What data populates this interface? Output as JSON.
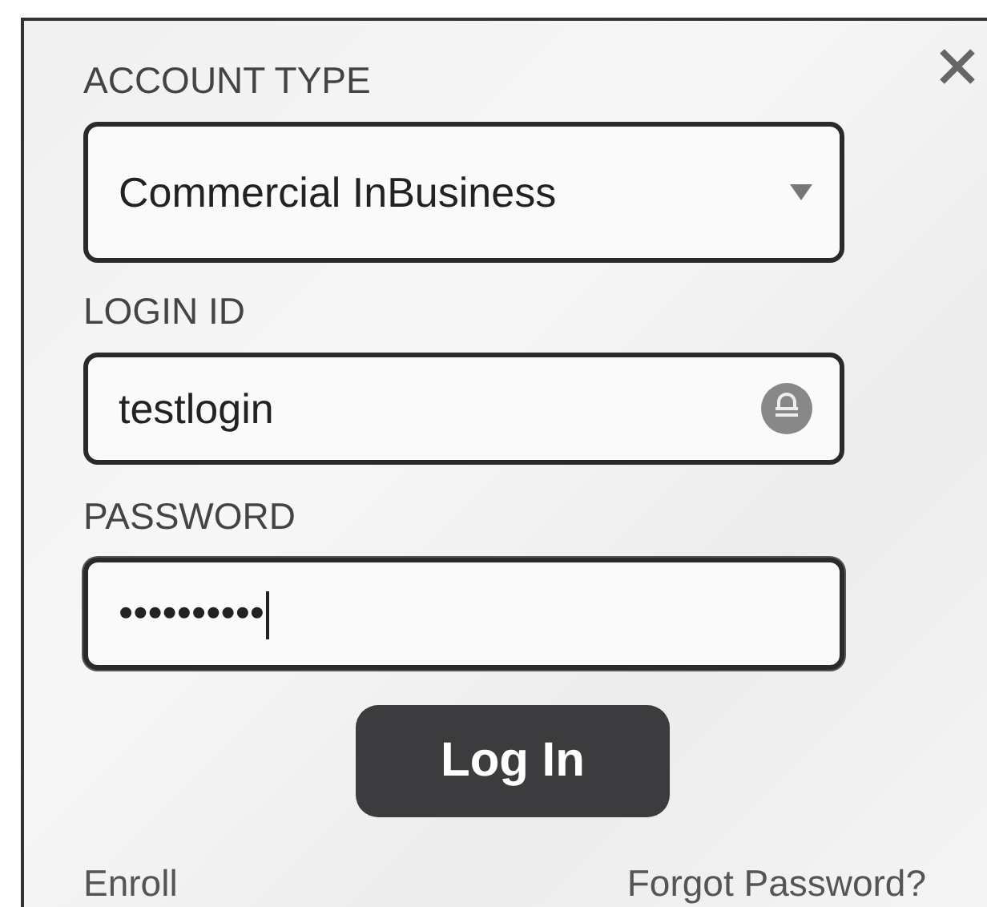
{
  "account_type": {
    "label": "ACCOUNT TYPE",
    "value": "Commercial InBusiness"
  },
  "login_id": {
    "label": "LOGIN ID",
    "value": "testlogin"
  },
  "password": {
    "label": "PASSWORD",
    "value": "••••••••••",
    "focused": true
  },
  "login_button": "Log In",
  "links": [
    "Enroll",
    "Forgot Password?"
  ]
}
